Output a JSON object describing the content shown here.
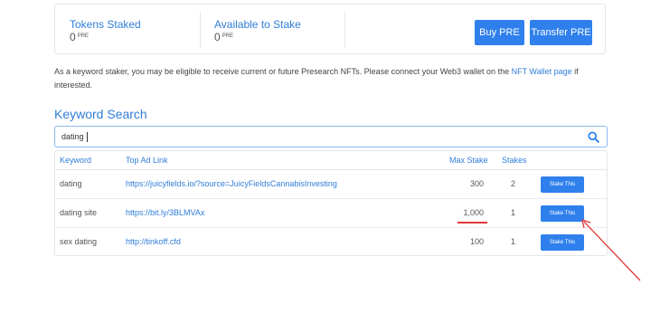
{
  "stats": {
    "tokens_staked": {
      "label": "Tokens Staked",
      "value": "0",
      "unit": "PRE"
    },
    "available": {
      "label": "Available to Stake",
      "value": "0",
      "unit": "PRE"
    }
  },
  "buttons": {
    "buy": "Buy PRE",
    "transfer": "Transfer PRE"
  },
  "notice": {
    "before": "As a keyword staker, you may be eligible to receive current or future Presearch NFTs. Please connect your Web3 wallet on the ",
    "link": "NFT Wallet page",
    "after": " if interested."
  },
  "section_title": "Keyword Search",
  "search": {
    "value": "dating"
  },
  "table": {
    "headers": {
      "keyword": "Keyword",
      "top_ad": "Top Ad Link",
      "max_stake": "Max Stake",
      "stakes": "Stakes"
    },
    "rows": [
      {
        "keyword": "dating",
        "link": "https://juicyfields.io/?source=JuicyFieldsCannabisInvesting",
        "max_stake": "300",
        "stakes": "2",
        "action": "Stake This"
      },
      {
        "keyword": "dating site",
        "link": "https://bit.ly/3BLMVAx",
        "max_stake": "1,000",
        "stakes": "1",
        "action": "Stake This"
      },
      {
        "keyword": "sex dating",
        "link": "http://tinkoff.cfd",
        "max_stake": "100",
        "stakes": "1",
        "action": "Stake This"
      }
    ]
  },
  "colors": {
    "accent": "#2f80ed",
    "link": "#2f7ed8",
    "annotation": "#e03a3a"
  },
  "icons": {
    "search": "search-icon"
  }
}
